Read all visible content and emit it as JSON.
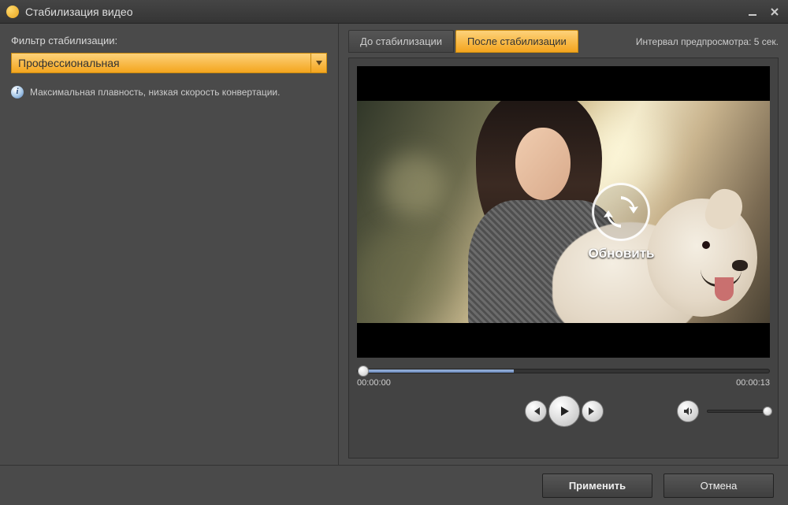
{
  "window": {
    "title": "Стабилизация видео"
  },
  "left": {
    "filter_label": "Фильтр стабилизации:",
    "filter_value": "Профессиональная",
    "info_text": "Максимальная плавность, низкая скорость конвертации."
  },
  "tabs": {
    "before": "До стабилизации",
    "after": "После стабилизации"
  },
  "preview": {
    "interval_label": "Интервал предпросмотра: 5 сек.",
    "refresh_label": "Обновить"
  },
  "playback": {
    "current_time": "00:00:00",
    "total_time": "00:00:13"
  },
  "footer": {
    "apply": "Применить",
    "cancel": "Отмена"
  }
}
